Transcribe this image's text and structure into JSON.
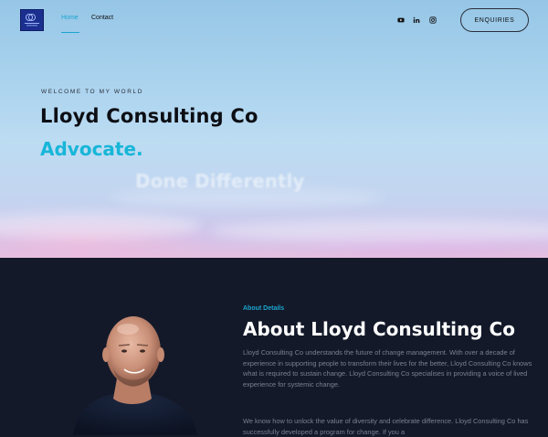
{
  "header": {
    "logo_icon": "lloyd-consulting-logo",
    "nav": [
      {
        "label": "Home",
        "active": true
      },
      {
        "label": "Contact",
        "active": false
      }
    ],
    "social_icons": [
      "youtube-icon",
      "linkedin-icon",
      "instagram-icon"
    ],
    "enquiries_label": "ENQUIRIES"
  },
  "hero": {
    "kicker": "WELCOME TO MY WORLD",
    "title": "Lloyd Consulting Co",
    "subtitle": "Advocate.",
    "faded_text": "Done Differently"
  },
  "about": {
    "kicker": "About Details",
    "title": "About Lloyd Consulting Co",
    "paragraph1": "Lloyd Consulting Co understands the future of change management. With over a decade of experience in supporting people to transform their lives for the better, Lloyd Consulting Co knows what is required to sustain change. Lloyd Consulting Co specialises in providing a voice of lived experience for systemic change.",
    "paragraph2": "We know how to unlock the value of diversity and celebrate difference. Lloyd Consulting Co has successfully developed a program for change. If you a"
  },
  "colors": {
    "accent": "#17b6d8",
    "dark_bg": "#131929",
    "body_text": "#7a8092"
  }
}
